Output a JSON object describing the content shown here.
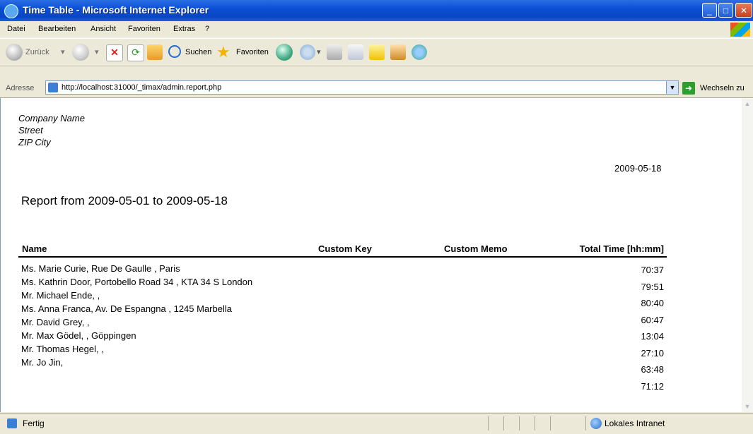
{
  "window": {
    "title": "Time Table - Microsoft Internet Explorer"
  },
  "menu": [
    "Datei",
    "Bearbeiten",
    "Ansicht",
    "Favoriten",
    "Extras",
    "?"
  ],
  "toolbar": {
    "back_label": "Zurück",
    "search_label": "Suchen",
    "favorites_label": "Favoriten"
  },
  "address": {
    "label": "Adresse",
    "url": "http://localhost:31000/_timax/admin.report.php",
    "go_label": "Wechseln zu"
  },
  "page": {
    "company": [
      "Company Name",
      "Street",
      "ZIP City"
    ],
    "date": "2009-05-18",
    "title": "Report from 2009-05-01 to 2009-05-18",
    "columns": [
      "Name",
      "Custom Key",
      "Custom Memo",
      "Total Time [hh:mm]"
    ],
    "names": [
      "Ms. Marie Curie, Rue De Gaulle , Paris",
      "Ms. Kathrin Door, Portobello Road 34 , KTA 34 S London",
      "Mr. Michael Ende, ,",
      "Ms. Anna Franca, Av. De Espangna , 1245 Marbella",
      "Mr. David Grey, ,",
      "Mr. Max Gödel, , Göppingen",
      "Mr. Thomas Hegel, ,",
      "Mr. Jo Jin,"
    ],
    "times": [
      "70:37",
      "79:51",
      "80:40",
      "60:47",
      "13:04",
      "27:10",
      "63:48",
      "71:12"
    ]
  },
  "status": {
    "left": "Fertig",
    "zone": "Lokales Intranet"
  }
}
